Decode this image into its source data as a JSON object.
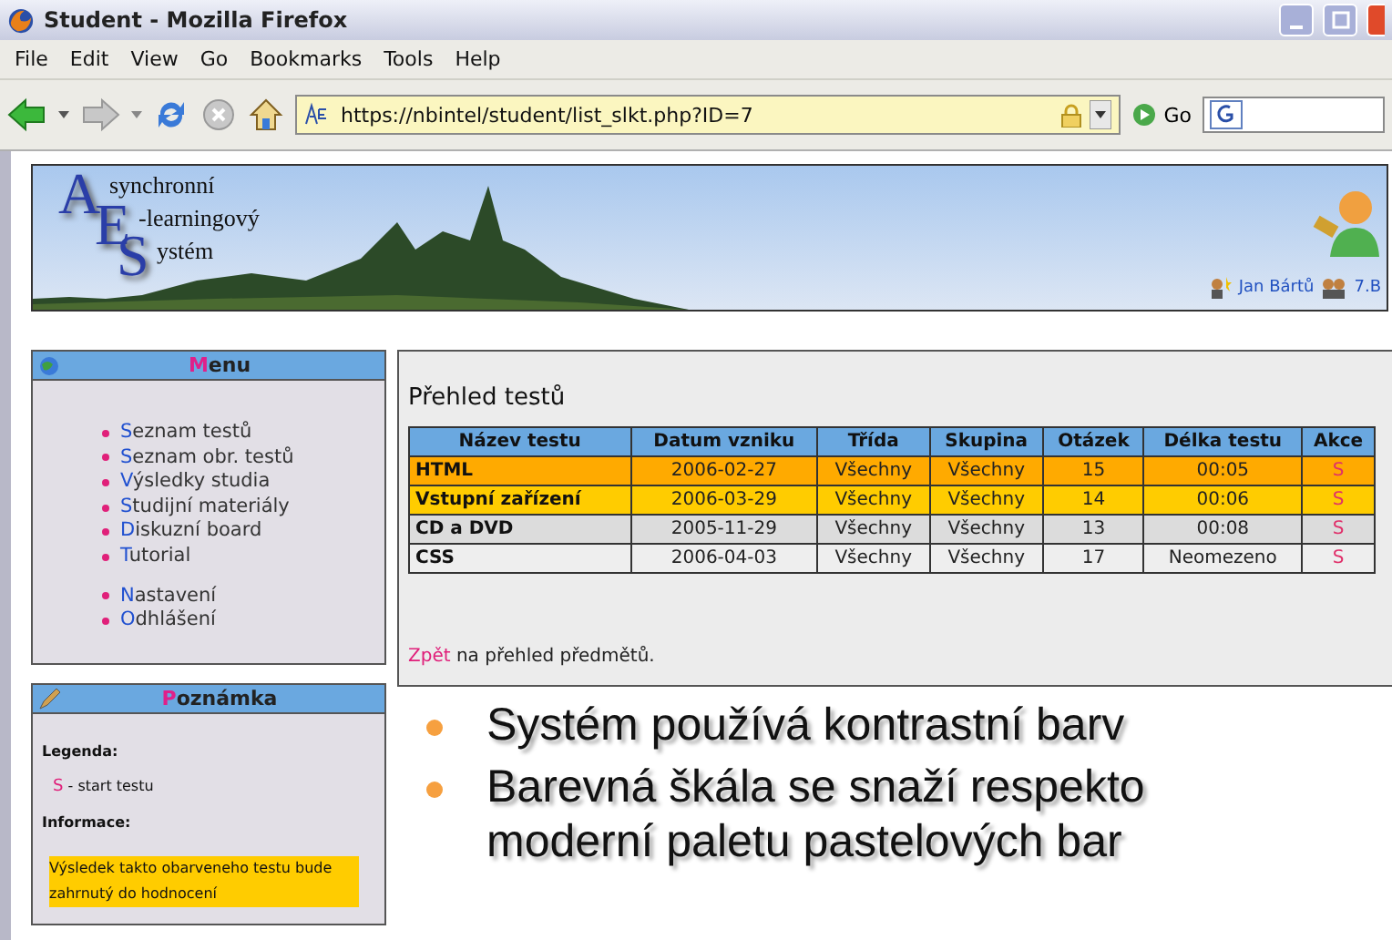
{
  "window": {
    "title": "Student - Mozilla Firefox"
  },
  "menubar": [
    "File",
    "Edit",
    "View",
    "Go",
    "Bookmarks",
    "Tools",
    "Help"
  ],
  "toolbar": {
    "url": "https://nbintel/student/list_slkt.php?ID=7",
    "go": "Go"
  },
  "banner": {
    "logo_letters": [
      "A",
      "E",
      "S"
    ],
    "logo_lines": [
      "synchronní",
      "-learningový",
      "ystém"
    ],
    "user": "Jan Bártů",
    "class": "7.B"
  },
  "menu": {
    "title": "Menu",
    "groups": [
      [
        "Seznam testů",
        "Seznam obr. testů",
        "Výsledky studia",
        "Studijní materiály",
        "Diskuzní board",
        "Tutorial"
      ],
      [
        "Nastavení",
        "Odhlášení"
      ]
    ]
  },
  "main": {
    "heading": "Přehled testů",
    "columns": [
      "Název testu",
      "Datum vzniku",
      "Třída",
      "Skupina",
      "Otázek",
      "Délka testu",
      "Akce"
    ],
    "rows": [
      {
        "cells": [
          "HTML",
          "2006-02-27",
          "Všechny",
          "Všechny",
          "15",
          "00:05",
          "S"
        ],
        "color": "#ffaa00"
      },
      {
        "cells": [
          "Vstupní zařízení",
          "2006-03-29",
          "Všechny",
          "Všechny",
          "14",
          "00:06",
          "S"
        ],
        "color": "#ffcc00"
      },
      {
        "cells": [
          "CD a DVD",
          "2005-11-29",
          "Všechny",
          "Všechny",
          "13",
          "00:08",
          "S"
        ],
        "color": "#dcdcdc"
      },
      {
        "cells": [
          "CSS",
          "2006-04-03",
          "Všechny",
          "Všechny",
          "17",
          "Neomezeno",
          "S"
        ],
        "color": "#eeeeee"
      }
    ],
    "back_link": "Zpět",
    "back_text": " na přehled předmětů."
  },
  "note": {
    "title": "Poznámka",
    "legend_label": "Legenda:",
    "legend_key": "S",
    "legend_text": "- start testu",
    "info_label": "Informace:",
    "info_text": "Výsledek takto obarveneho testu bude zahrnutý do hodnocení"
  },
  "slide_bullets": [
    {
      "lines": [
        "Systém používá kontrastní barv"
      ]
    },
    {
      "lines": [
        "Barevná škála se snaží respekto",
        "moderní paletu pastelových bar"
      ]
    }
  ]
}
